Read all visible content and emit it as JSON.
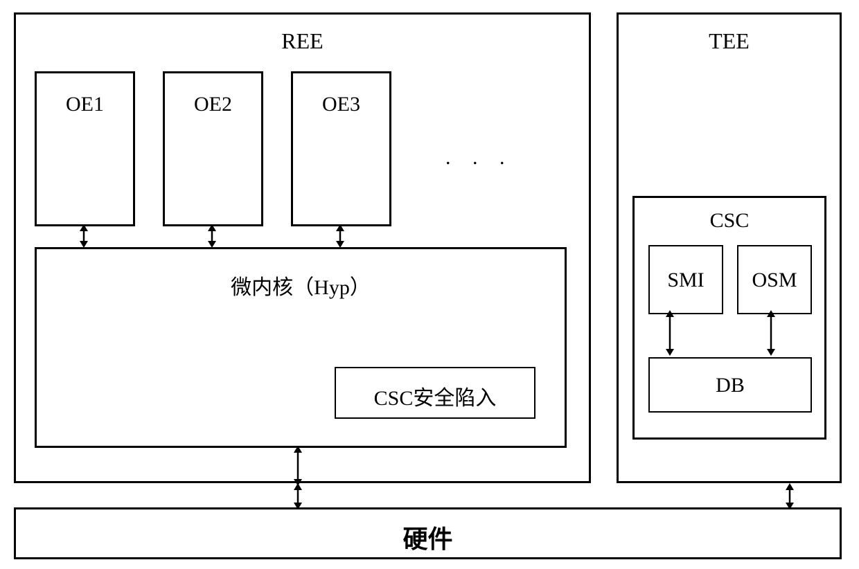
{
  "ree": {
    "title": "REE",
    "oe": [
      "OE1",
      "OE2",
      "OE3"
    ],
    "ellipsis": ". . .",
    "hyp_label": "微内核（Hyp）",
    "csc_trap": "CSC安全陷入"
  },
  "tee": {
    "title": "TEE",
    "csc": {
      "title": "CSC",
      "smi": "SMI",
      "osm": "OSM",
      "db": "DB"
    }
  },
  "hardware": "硬件"
}
